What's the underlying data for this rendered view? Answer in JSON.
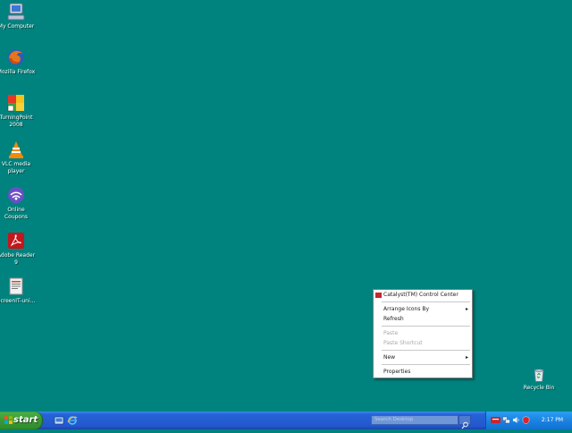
{
  "desktop": {
    "background_color": "#00837e",
    "icons": [
      {
        "name": "my-computer-icon",
        "label1": "My Computer",
        "label2": ""
      },
      {
        "name": "firefox-icon",
        "label1": "Mozilla Firefox",
        "label2": ""
      },
      {
        "name": "turningpoint-icon",
        "label1": "TurningPoint",
        "label2": "2008"
      },
      {
        "name": "vlc-icon",
        "label1": "VLC media",
        "label2": "player"
      },
      {
        "name": "coupons-icon",
        "label1": "Online",
        "label2": "Coupons"
      },
      {
        "name": "adobe-reader-icon",
        "label1": "Adobe Reader",
        "label2": "9"
      },
      {
        "name": "document-icon",
        "label1": "ScreenIT-uni...",
        "label2": ""
      }
    ],
    "recycle_bin": {
      "label": "Recycle Bin"
    }
  },
  "context_menu": {
    "items": [
      {
        "label": "Catalyst(TM) Control Center",
        "disabled": false,
        "submenu": false
      },
      {
        "label": "Arrange Icons By",
        "disabled": false,
        "submenu": true
      },
      {
        "label": "Refresh",
        "disabled": false,
        "submenu": false
      },
      {
        "label": "Paste",
        "disabled": true,
        "submenu": false
      },
      {
        "label": "Paste Shortcut",
        "disabled": true,
        "submenu": false
      },
      {
        "label": "New",
        "disabled": false,
        "submenu": true
      },
      {
        "label": "Properties",
        "disabled": false,
        "submenu": false
      }
    ]
  },
  "taskbar": {
    "start_label": "start",
    "quick_launch": [
      "show-desktop-icon",
      "internet-explorer-icon"
    ],
    "search_placeholder": "Search Desktop",
    "tray_icons": [
      "ati-icon",
      "network-icon",
      "volume-icon",
      "security-icon"
    ],
    "clock": "2:17 PM"
  }
}
